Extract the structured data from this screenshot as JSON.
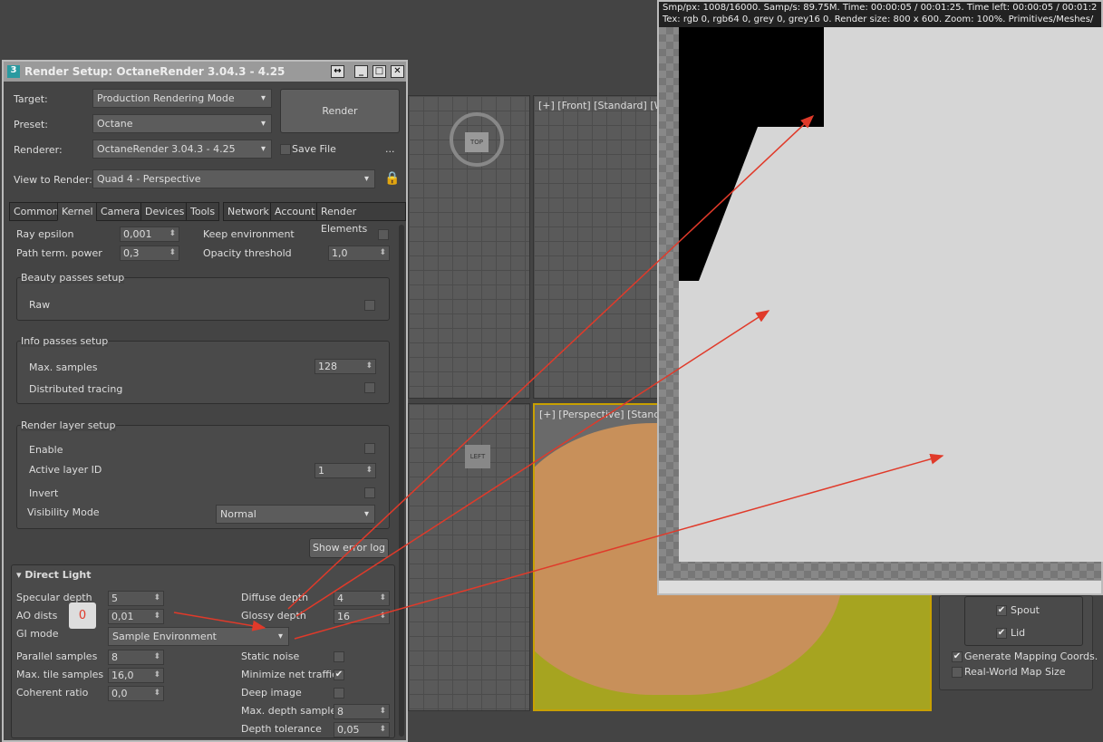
{
  "dialog": {
    "title": "Render Setup: OctaneRender 3.04.3 - 4.25",
    "icon": "3",
    "target_label": "Target:",
    "target": "Production Rendering Mode",
    "preset_label": "Preset:",
    "preset": "Octane",
    "renderer_label": "Renderer:",
    "renderer": "OctaneRender 3.04.3 - 4.25",
    "save_file": "Save File",
    "more": "...",
    "render": "Render",
    "view_label": "View to Render:",
    "view": "Quad 4 - Perspective",
    "tabs": [
      "Common",
      "Kernel",
      "Camera",
      "Devices",
      "Tools",
      "Network",
      "Account",
      "Render Elements"
    ]
  },
  "kernel": {
    "ray_epsilon_label": "Ray epsilon",
    "ray_epsilon": "0,001",
    "path_term_label": "Path term. power",
    "path_term": "0,3",
    "keep_env": "Keep environment",
    "opacity_label": "Opacity threshold",
    "opacity": "1,0",
    "beauty": "Beauty passes setup",
    "raw": "Raw",
    "info": "Info passes setup",
    "max_samples_label": "Max. samples",
    "max_samples": "128",
    "distributed": "Distributed tracing",
    "layer": "Render layer setup",
    "enable": "Enable",
    "active_layer_label": "Active layer ID",
    "active_layer": "1",
    "invert": "Invert",
    "visibility_label": "Visibility Mode",
    "visibility": "Normal",
    "error_log": "Show error log"
  },
  "direct": {
    "title": "Direct Light",
    "specular_label": "Specular depth",
    "specular": "5",
    "ao_label": "AO dists",
    "ao": "0,01",
    "badge": "0",
    "gi_label": "GI mode",
    "gi": "Sample Environment",
    "parallel_label": "Parallel samples",
    "parallel": "8",
    "tile_label": "Max. tile samples",
    "tile": "16,0",
    "coherent_label": "Coherent ratio",
    "coherent": "0,0",
    "diffuse_label": "Diffuse depth",
    "diffuse": "4",
    "glossy_label": "Glossy depth",
    "glossy": "16",
    "static_noise": "Static noise",
    "minimize": "Minimize net traffic",
    "deep": "Deep image",
    "max_depth_label": "Max. depth samples",
    "max_depth": "8",
    "depth_tol_label": "Depth tolerance",
    "depth_tol": "0,05"
  },
  "viewports": {
    "front": "[+] [Front] [Standard] [W",
    "persp": "[+] [Perspective] [Standa",
    "top": "TOP",
    "left": "LEFT"
  },
  "render_window": {
    "line1": "Smp/px: 1008/16000.   Samp/s: 89.75M.   Time: 00:00:05 / 00:01:25.   Time left: 00:00:05 / 00:01:2",
    "line2": "Tex: rgb 0, rgb64 0, grey 0, grey16 0.   Render size: 800 x 600.   Zoom: 100%.   Primitives/Meshes/"
  },
  "params": {
    "spout": "Spout",
    "lid": "Lid",
    "gen_mapping": "Generate Mapping Coords.",
    "real_world": "Real-World Map Size"
  },
  "colors": {
    "arrow": "#e03a2a",
    "teapot": "#c8905a",
    "ground": "#a6a420"
  }
}
